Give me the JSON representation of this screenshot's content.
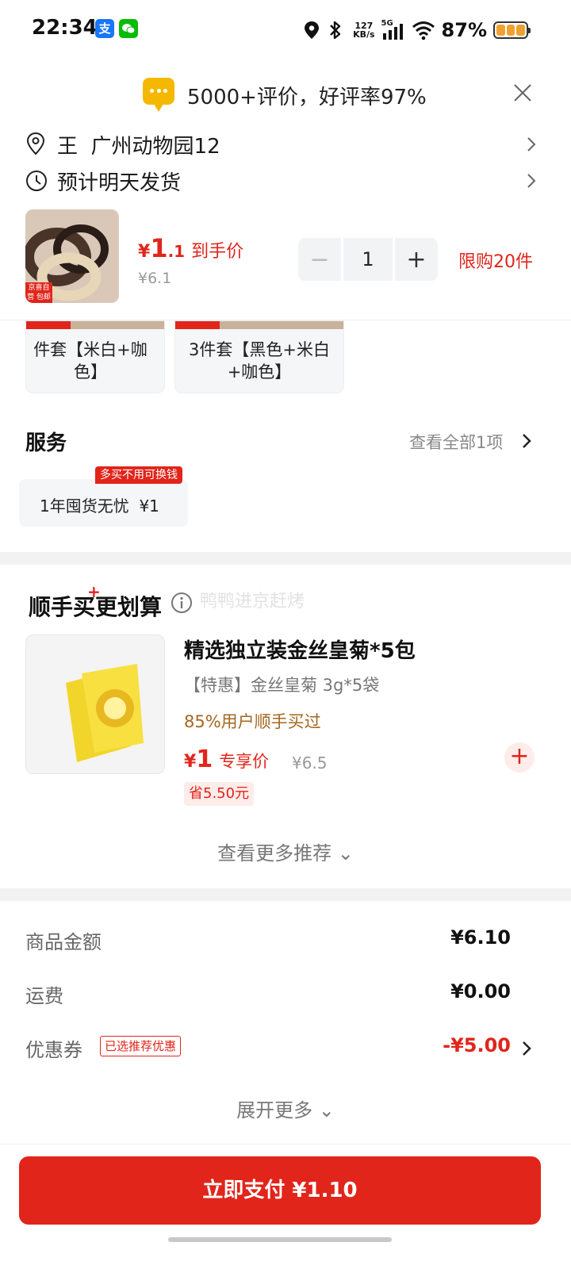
{
  "status_bar": {
    "time": "22:34",
    "alipay_glyph": "支",
    "net_speed_value": "127",
    "net_speed_unit": "KB/s",
    "network": "5G",
    "battery": "87%",
    "icons": [
      "alipay-icon",
      "wechat-icon",
      "location-icon",
      "bluetooth-icon",
      "signal-icon",
      "wifi-icon",
      "battery-icon"
    ]
  },
  "review_banner": {
    "text": "5000+评价，好评率97%"
  },
  "address": {
    "text": "王  广州动物园12"
  },
  "delivery": {
    "text": "预计明天发货"
  },
  "product": {
    "tag": "京喜自营 包邮",
    "price_yen": "¥",
    "price_int": "1",
    "price_dec": ".1",
    "price_label": "到手价",
    "price_original": "¥6.1",
    "quantity": "1",
    "limit": "限购20件"
  },
  "variants": [
    {
      "label": "件套【米白+咖色】"
    },
    {
      "label": "3件套【黑色+米白+咖色】"
    }
  ],
  "services": {
    "title": "服务",
    "see_all": "查看全部1项",
    "item": "1年囤货无忧  ¥1",
    "badge": "多买不用可换钱"
  },
  "bundle": {
    "title": "顺手买更划算",
    "watermark": "鸭鸭进京赶烤",
    "item": {
      "name": "精选独立装金丝皇菊*5包",
      "desc": "【特惠】金丝皇菊 3g*5袋",
      "bought": "85%用户顺手买过",
      "price_yen": "¥",
      "price": "1",
      "price_label": "专享价",
      "original": "¥6.5",
      "save": "省5.50元"
    },
    "see_more": "查看更多推荐 ⌄"
  },
  "totals": {
    "goods_label": "商品金额",
    "goods_value": "¥6.10",
    "shipping_label": "运费",
    "shipping_value": "¥0.00",
    "coupon_label": "优惠券",
    "coupon_tag": "已选推荐优惠",
    "coupon_value": "-¥5.00",
    "expand": "展开更多 ⌄"
  },
  "pay_button": "立即支付 ¥1.10",
  "colors": {
    "accent": "#e1251b",
    "gold": "#a4661f",
    "banner_icon": "#f5b800"
  }
}
